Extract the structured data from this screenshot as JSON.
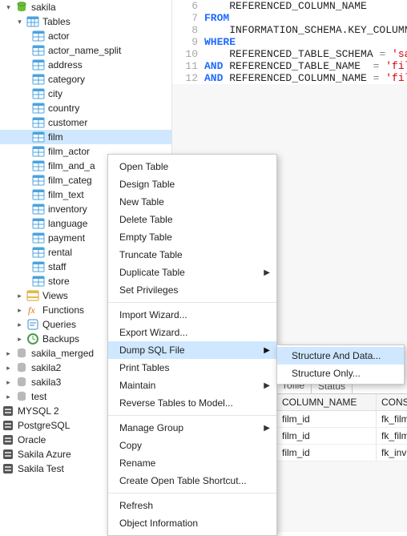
{
  "tree": {
    "root": "sakila",
    "tables_label": "Tables",
    "tables": [
      "actor",
      "actor_name_split",
      "address",
      "category",
      "city",
      "country",
      "customer",
      "film",
      "film_actor",
      "film_and_a",
      "film_categ",
      "film_text",
      "inventory",
      "language",
      "payment",
      "rental",
      "staff",
      "store"
    ],
    "selected_table": "film",
    "groups": {
      "views": "Views",
      "functions": "Functions",
      "queries": "Queries",
      "backups": "Backups"
    },
    "dbs": [
      "sakila_merged",
      "sakila2",
      "sakila3",
      "test"
    ],
    "connections": [
      "MYSQL 2",
      "PostgreSQL",
      "Oracle",
      "Sakila Azure",
      "Sakila Test"
    ]
  },
  "menu": {
    "open_table": "Open Table",
    "design_table": "Design Table",
    "new_table": "New Table",
    "delete_table": "Delete Table",
    "empty_table": "Empty Table",
    "truncate_table": "Truncate Table",
    "duplicate_table": "Duplicate Table",
    "set_privileges": "Set Privileges",
    "import_wizard": "Import Wizard...",
    "export_wizard": "Export Wizard...",
    "dump_sql_file": "Dump SQL File",
    "print_tables": "Print Tables",
    "maintain": "Maintain",
    "reverse_tables": "Reverse Tables to Model...",
    "manage_group": "Manage Group",
    "copy": "Copy",
    "rename": "Rename",
    "create_shortcut": "Create Open Table Shortcut...",
    "refresh": "Refresh",
    "object_info": "Object Information"
  },
  "submenu": {
    "structure_and_data": "Structure And Data...",
    "structure_only": "Structure Only..."
  },
  "sql": {
    "lines": [
      "6",
      "7",
      "8",
      "9",
      "10",
      "11",
      "12"
    ],
    "l6": "    REFERENCED_COLUMN_NAME",
    "l7_kw": "FROM",
    "l8": "    INFORMATION_SCHEMA.KEY_COLUMN_",
    "l9_kw": "WHERE",
    "l10a": "    REFERENCED_TABLE_SCHEMA ",
    "l10eq": "= ",
    "l10s": "'sak",
    "l11and": "AND",
    "l11a": " REFERENCED_TABLE_NAME  ",
    "l11eq": "= ",
    "l11s": "'fil",
    "l12and": "AND",
    "l12a": " REFERENCED_COLUMN_NAME ",
    "l12eq": "= ",
    "l12s": "'fil"
  },
  "grid": {
    "tab_profile": "rofile",
    "tab_status": "Status",
    "col1": "COLUMN_NAME",
    "col2": "CONS",
    "rows": [
      {
        "c1": "film_id",
        "c2": "fk_film"
      },
      {
        "c1": "film_id",
        "c2": "fk_film"
      },
      {
        "c1": "film_id",
        "c2": "fk_inv"
      }
    ]
  }
}
